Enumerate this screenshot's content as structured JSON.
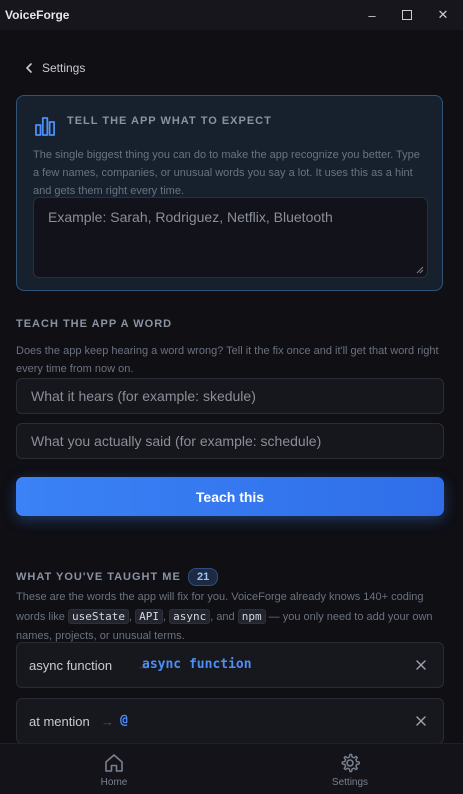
{
  "app": {
    "title": "VoiceForge"
  },
  "window_controls": {
    "minimize": "–",
    "maximize": "☐",
    "close": "✕"
  },
  "back": {
    "label": "Settings"
  },
  "expect": {
    "title": "TELL THE APP WHAT TO EXPECT",
    "description": "The single biggest thing you can do to make the app recognize you better. Type a few names, companies, or unusual words you say a lot. It uses this as a hint and gets them right every time.",
    "placeholder": "Example: Sarah, Rodriguez, Netflix, Bluetooth"
  },
  "teach": {
    "title": "TEACH THE APP A WORD",
    "description": "Does the app keep hearing a word wrong? Tell it the fix once and it'll get that word right every time from now on.",
    "hears_placeholder": "What it hears (for example: skedule)",
    "said_placeholder": "What you actually said (for example: schedule)",
    "button": "Teach this"
  },
  "taught": {
    "title": "WHAT YOU'VE TAUGHT ME",
    "count": "21",
    "desc_pre": "These are the words the app will fix for you. VoiceForge already knows 140+ coding words like",
    "chips": [
      "useState",
      "API",
      "async",
      "npm"
    ],
    "comma": ",",
    "and_text": ", and",
    "desc_post": "— you only need to add your own names, projects, or unusual terms.",
    "items": [
      {
        "from": "async function",
        "arrow": "→",
        "to": "async function"
      },
      {
        "from": "at mention",
        "arrow": "→",
        "to": "@"
      }
    ]
  },
  "nav": [
    {
      "label": "Home",
      "icon": "home-icon"
    },
    {
      "label": "Settings",
      "icon": "gear-icon"
    }
  ],
  "colors": {
    "accent": "#3b82f6",
    "background": "#0f0f14"
  }
}
